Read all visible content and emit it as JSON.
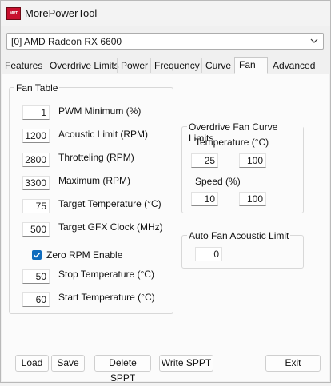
{
  "window": {
    "title": "MorePowerTool",
    "icon_text": "MPT"
  },
  "device": {
    "selected": "[0] AMD Radeon RX 6600"
  },
  "tabs": [
    "Features",
    "Overdrive Limits",
    "Power",
    "Frequency",
    "Curve",
    "Fan",
    "Advanced"
  ],
  "active_tab": "Fan",
  "fan_table": {
    "title": "Fan Table",
    "pwm_min": {
      "label": "PWM Minimum (%)",
      "value": "1"
    },
    "acoustic_limit": {
      "label": "Acoustic Limit (RPM)",
      "value": "1200"
    },
    "throttling": {
      "label": "Throtteling (RPM)",
      "value": "2800"
    },
    "maximum": {
      "label": "Maximum (RPM)",
      "value": "3300"
    },
    "target_temp": {
      "label": "Target Temperature (°C)",
      "value": "75"
    },
    "target_gfx": {
      "label": "Target GFX Clock (MHz)",
      "value": "500"
    },
    "zero_rpm": {
      "label": "Zero RPM Enable",
      "checked": true
    },
    "stop_temp": {
      "label": "Stop Temperature (°C)",
      "value": "50"
    },
    "start_temp": {
      "label": "Start Temperature (°C)",
      "value": "60"
    }
  },
  "od_limits": {
    "title": "Overdrive Fan Curve Limits",
    "temperature_label": "Temperature (°C)",
    "temp_min": "25",
    "temp_max": "100",
    "speed_label": "Speed (%)",
    "speed_min": "10",
    "speed_max": "100"
  },
  "auto_fan": {
    "title": "Auto Fan Acoustic Limit",
    "value": "0"
  },
  "buttons": {
    "load": "Load",
    "save": "Save",
    "delete_sppt": "Delete SPPT",
    "write_sppt": "Write SPPT",
    "exit": "Exit"
  },
  "colors": {
    "accent": "#0f6cbd",
    "app_icon": "#c8102e"
  }
}
